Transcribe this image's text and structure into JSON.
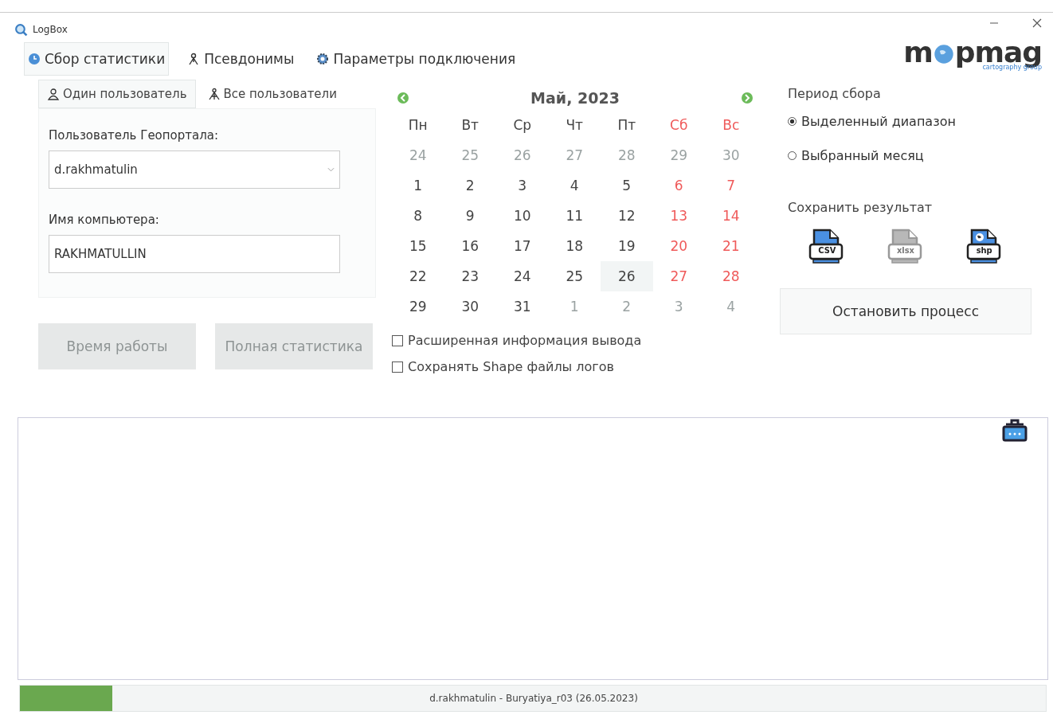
{
  "window": {
    "title": "LogBox"
  },
  "logo": {
    "before": "m",
    "after": "pmag",
    "tagline": "cartography group"
  },
  "tabs": [
    {
      "label": "Сбор статистики",
      "selected": true
    },
    {
      "label": "Псевдонимы",
      "selected": false
    },
    {
      "label": "Параметры подключения",
      "selected": false
    }
  ],
  "subtabs": [
    {
      "label": "Один пользователь",
      "selected": true
    },
    {
      "label": "Все пользователи",
      "selected": false
    }
  ],
  "user_label": "Пользователь Геопортала:",
  "user_value": "d.rakhmatulin",
  "computer_label": "Имя компьютера:",
  "computer_value": "RAKHMATULLIN",
  "buttons": [
    {
      "label": "Время работы",
      "disabled": true
    },
    {
      "label": "Полная статистика",
      "disabled": true
    }
  ],
  "calendar": {
    "title": "Май, 2023",
    "weekdays": [
      {
        "label": "Пн",
        "weekend": false
      },
      {
        "label": "Вт",
        "weekend": false
      },
      {
        "label": "Ср",
        "weekend": false
      },
      {
        "label": "Чт",
        "weekend": false
      },
      {
        "label": "Пт",
        "weekend": false
      },
      {
        "label": "Сб",
        "weekend": true
      },
      {
        "label": "Вс",
        "weekend": true
      }
    ],
    "weeks": [
      [
        {
          "day": "24",
          "other_month": true,
          "selected": false
        },
        {
          "day": "25",
          "other_month": true,
          "selected": false
        },
        {
          "day": "26",
          "other_month": true,
          "selected": false
        },
        {
          "day": "27",
          "other_month": true,
          "selected": false
        },
        {
          "day": "28",
          "other_month": true,
          "selected": false
        },
        {
          "day": "29",
          "other_month": true,
          "selected": false
        },
        {
          "day": "30",
          "other_month": true,
          "selected": false
        }
      ],
      [
        {
          "day": "1",
          "other_month": false,
          "selected": false
        },
        {
          "day": "2",
          "other_month": false,
          "selected": false
        },
        {
          "day": "3",
          "other_month": false,
          "selected": false
        },
        {
          "day": "4",
          "other_month": false,
          "selected": false
        },
        {
          "day": "5",
          "other_month": false,
          "selected": false
        },
        {
          "day": "6",
          "other_month": false,
          "selected": false
        },
        {
          "day": "7",
          "other_month": false,
          "selected": false
        }
      ],
      [
        {
          "day": "8",
          "other_month": false,
          "selected": false
        },
        {
          "day": "9",
          "other_month": false,
          "selected": false
        },
        {
          "day": "10",
          "other_month": false,
          "selected": false
        },
        {
          "day": "11",
          "other_month": false,
          "selected": false
        },
        {
          "day": "12",
          "other_month": false,
          "selected": false
        },
        {
          "day": "13",
          "other_month": false,
          "selected": false
        },
        {
          "day": "14",
          "other_month": false,
          "selected": false
        }
      ],
      [
        {
          "day": "15",
          "other_month": false,
          "selected": false
        },
        {
          "day": "16",
          "other_month": false,
          "selected": false
        },
        {
          "day": "17",
          "other_month": false,
          "selected": false
        },
        {
          "day": "18",
          "other_month": false,
          "selected": false
        },
        {
          "day": "19",
          "other_month": false,
          "selected": false
        },
        {
          "day": "20",
          "other_month": false,
          "selected": false
        },
        {
          "day": "21",
          "other_month": false,
          "selected": false
        }
      ],
      [
        {
          "day": "22",
          "other_month": false,
          "selected": false
        },
        {
          "day": "23",
          "other_month": false,
          "selected": false
        },
        {
          "day": "24",
          "other_month": false,
          "selected": false
        },
        {
          "day": "25",
          "other_month": false,
          "selected": false
        },
        {
          "day": "26",
          "other_month": false,
          "selected": true
        },
        {
          "day": "27",
          "other_month": false,
          "selected": false
        },
        {
          "day": "28",
          "other_month": false,
          "selected": false
        }
      ],
      [
        {
          "day": "29",
          "other_month": false,
          "selected": false
        },
        {
          "day": "30",
          "other_month": false,
          "selected": false
        },
        {
          "day": "31",
          "other_month": false,
          "selected": false
        },
        {
          "day": "1",
          "other_month": true,
          "selected": false
        },
        {
          "day": "2",
          "other_month": true,
          "selected": false
        },
        {
          "day": "3",
          "other_month": true,
          "selected": false
        },
        {
          "day": "4",
          "other_month": true,
          "selected": false
        }
      ]
    ]
  },
  "options": [
    {
      "label": "Расширенная информация вывода",
      "checked": false
    },
    {
      "label": "Сохранять Shape файлы логов",
      "checked": false
    }
  ],
  "period": {
    "title": "Период сбора",
    "choices": [
      {
        "label": "Выделенный диапазон",
        "selected": true
      },
      {
        "label": "Выбранный месяц",
        "selected": false
      }
    ]
  },
  "save": {
    "title": "Сохранить результат",
    "formats": [
      {
        "label": "CSV",
        "disabled": false,
        "kind": "table"
      },
      {
        "label": "xlsx",
        "disabled": true,
        "kind": "table"
      },
      {
        "label": "shp",
        "disabled": false,
        "kind": "globe"
      }
    ]
  },
  "stop_button": "Остановить процесс",
  "status": {
    "level": 0.09,
    "text": "d.rakhmatulin - Buryatiya_r03 (26.05.2023)"
  }
}
